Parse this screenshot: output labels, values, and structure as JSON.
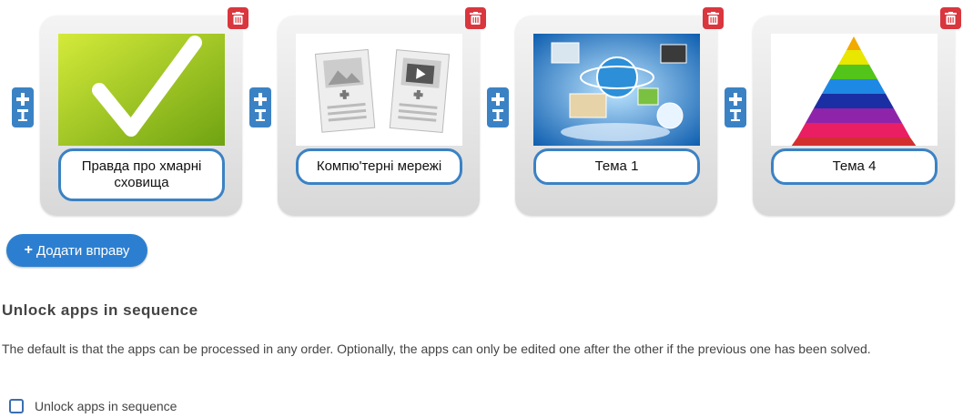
{
  "cards": [
    {
      "label": "Правда про хмарні сховища"
    },
    {
      "label": "Компю'терні мережі"
    },
    {
      "label": "Тема 1"
    },
    {
      "label": "Тема 4"
    }
  ],
  "add_button": {
    "label": "Додати вправу",
    "icon": "plus-icon"
  },
  "section": {
    "title": "Unlock apps in sequence",
    "description": "The default is that the apps can be processed in any order. Optionally, the apps can only be edited one after the other if the previous one has been solved.",
    "checkbox_label": "Unlock apps in sequence",
    "checkbox_checked": false
  },
  "colors": {
    "accent_blue": "#3b82c4",
    "delete_red": "#d9363e",
    "button_blue": "#2c7fd0"
  }
}
